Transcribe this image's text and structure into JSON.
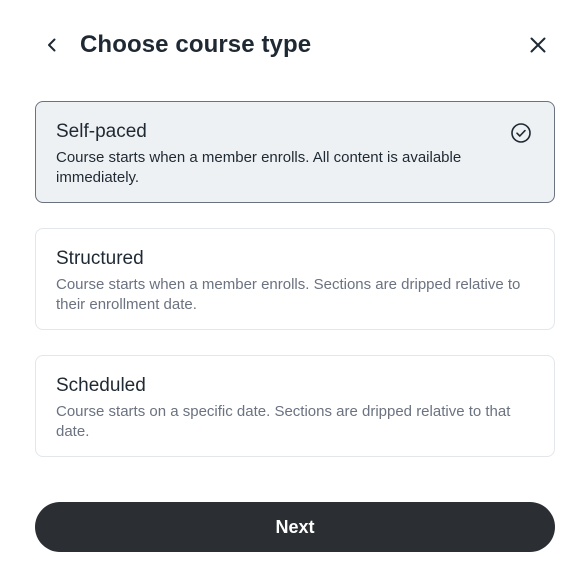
{
  "header": {
    "title": "Choose course type",
    "back_icon": "chevron-left-icon",
    "close_icon": "close-icon"
  },
  "options": [
    {
      "title": "Self-paced",
      "description": "Course starts when a member enrolls. All content is available immediately.",
      "selected": true
    },
    {
      "title": "Structured",
      "description": "Course starts when a member enrolls. Sections are dripped relative to their enrollment date.",
      "selected": false
    },
    {
      "title": "Scheduled",
      "description": "Course starts on a specific date. Sections are dripped relative to that date.",
      "selected": false
    }
  ],
  "footer": {
    "next_label": "Next"
  },
  "colors": {
    "selected_bg": "#eef1f4",
    "button_bg": "#2b2f33"
  }
}
